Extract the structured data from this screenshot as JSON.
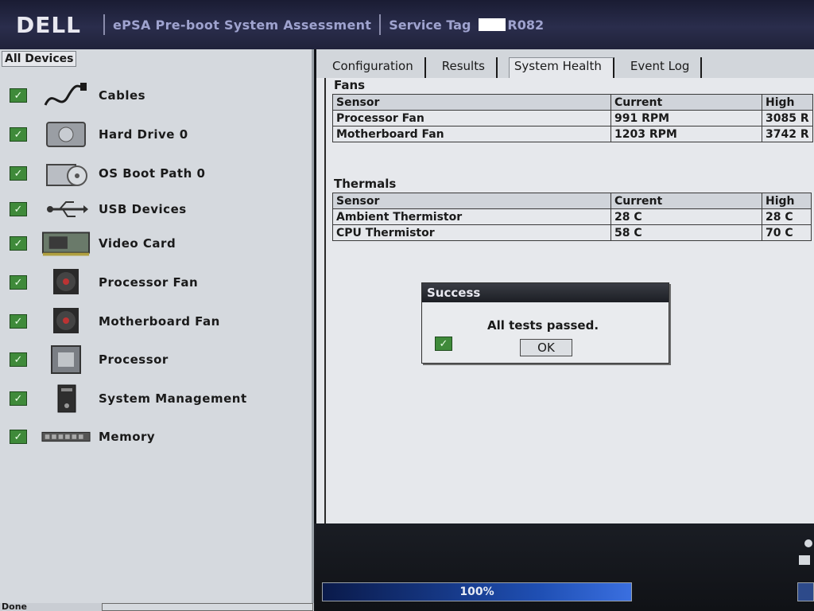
{
  "header": {
    "title": "ePSA Pre-boot System Assessment",
    "service_tag_label": "Service Tag",
    "service_tag_suffix": "R082",
    "logo_text": "DELL"
  },
  "sidebar": {
    "root_label": "All Devices",
    "items": [
      {
        "label": "Cables",
        "icon": "cable-icon",
        "status": "passed"
      },
      {
        "label": "Hard Drive 0",
        "icon": "hard-drive-icon",
        "status": "passed"
      },
      {
        "label": "OS Boot Path 0",
        "icon": "boot-path-icon",
        "status": "passed"
      },
      {
        "label": "USB Devices",
        "icon": "usb-icon",
        "status": "passed"
      },
      {
        "label": "Video Card",
        "icon": "video-card-icon",
        "status": "passed"
      },
      {
        "label": "Processor Fan",
        "icon": "fan-icon",
        "status": "passed"
      },
      {
        "label": "Motherboard Fan",
        "icon": "fan-icon",
        "status": "passed"
      },
      {
        "label": "Processor",
        "icon": "processor-icon",
        "status": "passed"
      },
      {
        "label": "System Management",
        "icon": "system-management-icon",
        "status": "passed"
      },
      {
        "label": "Memory",
        "icon": "memory-icon",
        "status": "passed"
      }
    ]
  },
  "tabs": [
    {
      "label": "Configuration",
      "active": false
    },
    {
      "label": "Results",
      "active": false
    },
    {
      "label": "System Health",
      "active": true
    },
    {
      "label": "Event Log",
      "active": false
    }
  ],
  "fans": {
    "title": "Fans",
    "headers": [
      "Sensor",
      "Current",
      "High"
    ],
    "rows": [
      [
        "Processor Fan",
        "991 RPM",
        "3085 R"
      ],
      [
        "Motherboard Fan",
        "1203 RPM",
        "3742 R"
      ]
    ]
  },
  "thermals": {
    "title": "Thermals",
    "headers": [
      "Sensor",
      "Current",
      "High"
    ],
    "rows": [
      [
        "Ambient Thermistor",
        "28 C",
        "28 C"
      ],
      [
        "CPU Thermistor",
        "58 C",
        "70 C"
      ]
    ]
  },
  "dialog": {
    "title": "Success",
    "message": "All tests passed.",
    "ok_label": "OK"
  },
  "progress": {
    "value": 1.0,
    "label": "100%"
  },
  "status_bar": {
    "left_text": "Done"
  },
  "colors": {
    "check_green": "#3f8a3a",
    "header_bg": "#2a2d4c",
    "progress_blue": "#1f4fb3"
  }
}
